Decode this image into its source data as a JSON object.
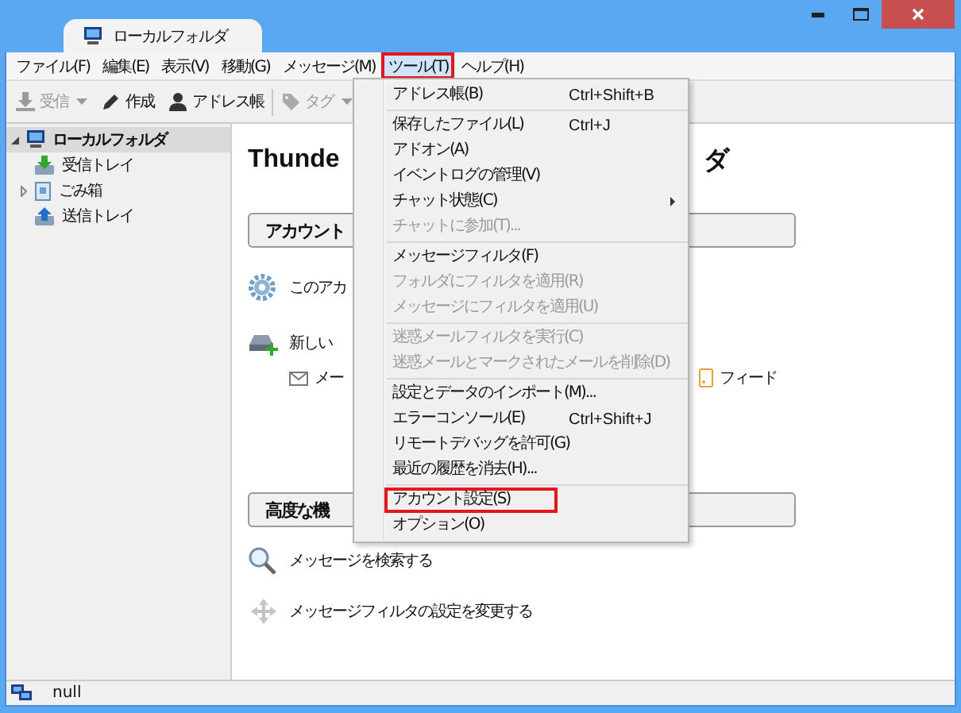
{
  "window": {
    "tab_title": "ローカルフォルダ"
  },
  "menubar": [
    {
      "label": "ファイル(F)",
      "selected": false,
      "annotated": false
    },
    {
      "label": "編集(E)",
      "selected": false,
      "annotated": false
    },
    {
      "label": "表示(V)",
      "selected": false,
      "annotated": false
    },
    {
      "label": "移動(G)",
      "selected": false,
      "annotated": false
    },
    {
      "label": "メッセージ(M)",
      "selected": false,
      "annotated": false
    },
    {
      "label": "ツール(T)",
      "selected": true,
      "annotated": true
    },
    {
      "label": "ヘルプ(H)",
      "selected": false,
      "annotated": false
    }
  ],
  "toolbar": [
    {
      "kind": "receive",
      "label": "受信",
      "disabled": true,
      "dropdown": true
    },
    {
      "kind": "write",
      "label": "作成",
      "disabled": false,
      "dropdown": false
    },
    {
      "kind": "address",
      "label": "アドレス帳",
      "disabled": false,
      "dropdown": false
    },
    {
      "kind": "separator"
    },
    {
      "kind": "tag",
      "label": "タグ",
      "disabled": true,
      "dropdown": true
    }
  ],
  "folders": [
    {
      "kind": "local",
      "label": "ローカルフォルダ",
      "selected": true,
      "expanded": true,
      "children": [
        {
          "kind": "inbox",
          "label": "受信トレイ",
          "selected": false
        },
        {
          "kind": "trash",
          "label": "ごみ箱",
          "selected": false,
          "expanded": false
        },
        {
          "kind": "outbox",
          "label": "送信トレイ",
          "selected": false
        }
      ]
    }
  ],
  "content": {
    "heading": [
      "Thunde",
      "ダ"
    ],
    "account_section": "アカウント",
    "account_items": [
      {
        "kind": "settings",
        "label": "このアカ"
      },
      {
        "kind": "new_account",
        "label": "新しい"
      }
    ],
    "new_account_options": [
      {
        "kind": "mail",
        "label": "メー"
      },
      {
        "kind": "feed",
        "label": "フィード"
      }
    ],
    "advanced_section": "高度な機",
    "advanced_items": [
      {
        "kind": "search",
        "label": "メッセージを検索する"
      },
      {
        "kind": "filter",
        "label": "メッセージフィルタの設定を変更する"
      }
    ]
  },
  "tools_menu": [
    {
      "kind": "item",
      "label": "アドレス帳(B)",
      "shortcut": "Ctrl+Shift+B",
      "disabled": false,
      "submenu": false,
      "annotated": false
    },
    {
      "kind": "separator"
    },
    {
      "kind": "item",
      "label": "保存したファイル(L)",
      "shortcut": "Ctrl+J",
      "disabled": false,
      "submenu": false,
      "annotated": false
    },
    {
      "kind": "item",
      "label": "アドオン(A)",
      "disabled": false,
      "submenu": false,
      "annotated": false
    },
    {
      "kind": "item",
      "label": "イベントログの管理(V)",
      "disabled": false,
      "submenu": false,
      "annotated": false
    },
    {
      "kind": "item",
      "label": "チャット状態(C)",
      "disabled": false,
      "submenu": true,
      "annotated": false
    },
    {
      "kind": "item",
      "label": "チャットに参加(T)...",
      "disabled": true,
      "submenu": false,
      "annotated": false
    },
    {
      "kind": "separator"
    },
    {
      "kind": "item",
      "label": "メッセージフィルタ(F)",
      "disabled": false,
      "submenu": false,
      "annotated": false
    },
    {
      "kind": "item",
      "label": "フォルダにフィルタを適用(R)",
      "disabled": true,
      "submenu": false,
      "annotated": false
    },
    {
      "kind": "item",
      "label": "メッセージにフィルタを適用(U)",
      "disabled": true,
      "submenu": false,
      "annotated": false
    },
    {
      "kind": "separator"
    },
    {
      "kind": "item",
      "label": "迷惑メールフィルタを実行(C)",
      "disabled": true,
      "submenu": false,
      "annotated": false
    },
    {
      "kind": "item",
      "label": "迷惑メールとマークされたメールを削除(D)",
      "disabled": true,
      "submenu": false,
      "annotated": false
    },
    {
      "kind": "separator"
    },
    {
      "kind": "item",
      "label": "設定とデータのインポート(M)...",
      "disabled": false,
      "submenu": false,
      "annotated": false
    },
    {
      "kind": "item",
      "label": "エラーコンソール(E)",
      "shortcut": "Ctrl+Shift+J",
      "disabled": false,
      "submenu": false,
      "annotated": false
    },
    {
      "kind": "item",
      "label": "リモートデバッグを許可(G)",
      "disabled": false,
      "submenu": false,
      "annotated": false
    },
    {
      "kind": "item",
      "label": "最近の履歴を消去(H)...",
      "disabled": false,
      "submenu": false,
      "annotated": false
    },
    {
      "kind": "separator"
    },
    {
      "kind": "item",
      "label": "アカウント設定(S)",
      "disabled": false,
      "submenu": false,
      "annotated": true
    },
    {
      "kind": "item",
      "label": "オプション(O)",
      "disabled": false,
      "submenu": false,
      "annotated": false
    }
  ],
  "status_bar": {
    "text": "null"
  }
}
